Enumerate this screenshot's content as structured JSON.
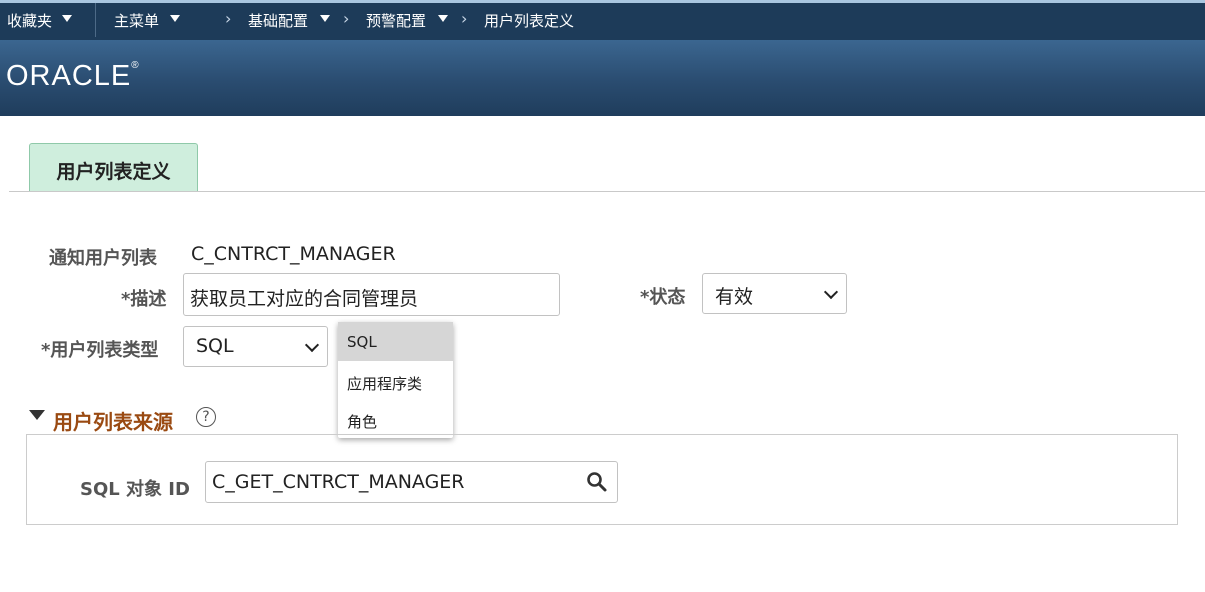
{
  "nav": {
    "favorites": "收藏夹",
    "main_menu": "主菜单",
    "breadcrumb_1": "基础配置",
    "breadcrumb_2": "预警配置",
    "breadcrumb_3": "用户列表定义",
    "chevron": "›"
  },
  "brand": {
    "logo_text": "ORACLE",
    "registered": "®"
  },
  "tab": {
    "label": "用户列表定义"
  },
  "form": {
    "notify_list_label": "通知用户列表",
    "notify_list_value": "C_CNTRCT_MANAGER",
    "description_label": "*描述",
    "description_value": "获取员工对应的合同管理员",
    "status_label": "*状态",
    "status_value": "有效",
    "list_type_label": "*用户列表类型",
    "list_type_value": "SQL"
  },
  "dropdown": {
    "options": [
      "SQL",
      "应用程序类",
      "角色"
    ],
    "selected": "SQL"
  },
  "section": {
    "title": "用户列表来源",
    "help": "?",
    "sql_id_label": "SQL 对象 ID",
    "sql_id_value": "C_GET_CNTRCT_MANAGER"
  },
  "colors": {
    "topbar": "#1d3b59",
    "tab_bg": "#cfeedd",
    "section_title": "#9a4a12"
  }
}
